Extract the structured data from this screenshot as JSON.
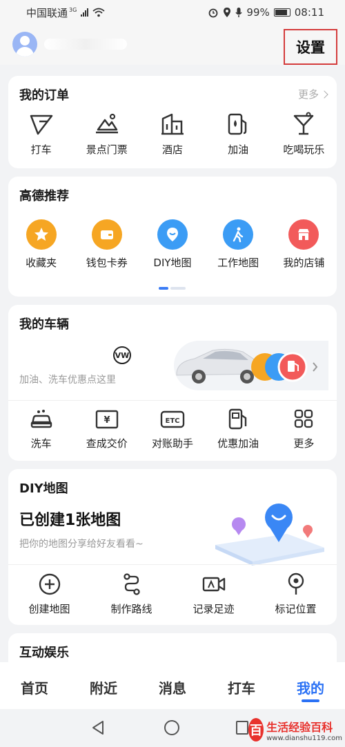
{
  "status": {
    "carrier": "中国联通",
    "network": "3G",
    "battery": "99%",
    "time": "08:11"
  },
  "header": {
    "settings_label": "设置"
  },
  "orders": {
    "title": "我的订单",
    "more": "更多",
    "items": [
      {
        "label": "打车",
        "icon": "taxi-icon"
      },
      {
        "label": "景点门票",
        "icon": "scenic-ticket-icon"
      },
      {
        "label": "酒店",
        "icon": "hotel-icon"
      },
      {
        "label": "加油",
        "icon": "fuel-icon"
      },
      {
        "label": "吃喝玩乐",
        "icon": "cocktail-icon"
      }
    ]
  },
  "recommend": {
    "title": "高德推荐",
    "items": [
      {
        "label": "收藏夹",
        "icon": "star-icon",
        "color": "#f6a623"
      },
      {
        "label": "钱包卡券",
        "icon": "wallet-icon",
        "color": "#f6a623"
      },
      {
        "label": "DIY地图",
        "icon": "diy-map-icon",
        "color": "#3b9cf5"
      },
      {
        "label": "工作地图",
        "icon": "walker-icon",
        "color": "#3b9cf5"
      },
      {
        "label": "我的店铺",
        "icon": "shop-icon",
        "color": "#f25a5a"
      }
    ]
  },
  "vehicle": {
    "title": "我的车辆",
    "subtitle": "加油、洗车优惠点这里",
    "brand_logo": "VW",
    "items": [
      {
        "label": "洗车",
        "icon": "car-wash-icon"
      },
      {
        "label": "查成交价",
        "icon": "price-icon"
      },
      {
        "label": "对账助手",
        "icon": "etc-icon"
      },
      {
        "label": "优惠加油",
        "icon": "fuel-discount-icon"
      },
      {
        "label": "更多",
        "icon": "grid-more-icon"
      }
    ]
  },
  "diy": {
    "title": "DIY地图",
    "headline": "已创建1张地图",
    "subtitle": "把你的地图分享给好友看看~",
    "items": [
      {
        "label": "创建地图",
        "icon": "plus-circle-icon"
      },
      {
        "label": "制作路线",
        "icon": "route-icon"
      },
      {
        "label": "记录足迹",
        "icon": "video-record-icon"
      },
      {
        "label": "标记位置",
        "icon": "location-pin-icon"
      }
    ]
  },
  "entertainment": {
    "title": "互动娱乐"
  },
  "tabs": [
    {
      "label": "首页",
      "active": false
    },
    {
      "label": "附近",
      "active": false
    },
    {
      "label": "消息",
      "active": false
    },
    {
      "label": "打车",
      "active": false
    },
    {
      "label": "我的",
      "active": true
    }
  ],
  "watermark": {
    "badge": "百",
    "title": "生活经验百科",
    "url": "www.dianshu119.com"
  }
}
